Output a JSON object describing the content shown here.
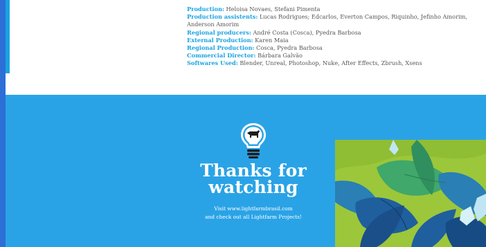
{
  "credits": [
    {
      "label": "Production:",
      "value": " Heloisa Novaes, Stefani Pimenta"
    },
    {
      "label": "Production assistents:",
      "value": " Lucas Rodrigues; Edcarlos, Everton Campos, Riquinho, Jefinho Amorim, Anderson Amorim"
    },
    {
      "label": "Regional producers:",
      "value": " André Costa (Cosca), Pyedra Barbosa"
    },
    {
      "label": "External Production:",
      "value": " Karen Maia"
    },
    {
      "label": "Regional Production:",
      "value": " Cosca, Pyedra Barbosa"
    },
    {
      "label": "Commercial Director:",
      "value": " Bárbara Galvão"
    },
    {
      "label": "Softwares Used:",
      "value": " Blender, Unreal, Photoshop, Nuke, After Effects, Zbrush, Xsens"
    }
  ],
  "outro": {
    "title_line1": "Thanks for",
    "title_line2": "watching",
    "visit_line1": "Visit www.lightfarmbrasil.com",
    "visit_line2": "and check out all Lightfarm Projects!"
  },
  "colors": {
    "accent": "#1aa3e0",
    "panel": "#2aa3e6",
    "page": "#2c6fd6"
  },
  "icons": {
    "logo": "lightbulb-cow-icon"
  }
}
